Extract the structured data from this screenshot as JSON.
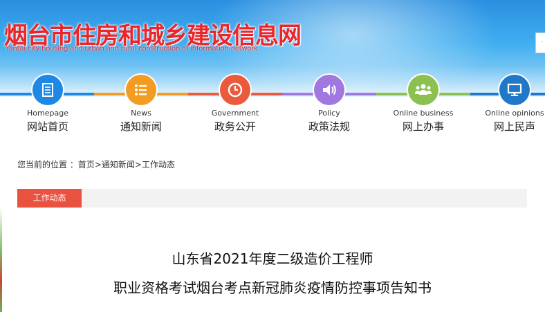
{
  "header": {
    "title": "烟台市住房和城乡建设信息网",
    "subtitle": "Yantai city housing and urban and rural construction of information network"
  },
  "nav": {
    "items": [
      {
        "en": "Homepage",
        "cn": "网站首页",
        "icon": "document-icon",
        "color": "#1e88e5"
      },
      {
        "en": "News",
        "cn": "通知新闻",
        "icon": "list-icon",
        "color": "#f39c23"
      },
      {
        "en": "Government",
        "cn": "政务公开",
        "icon": "clock-icon",
        "color": "#ea5a3d"
      },
      {
        "en": "Policy",
        "cn": "政策法规",
        "icon": "speaker-icon",
        "color": "#a178df"
      },
      {
        "en": "Online business",
        "cn": "网上办事",
        "icon": "people-icon",
        "color": "#8cc152"
      },
      {
        "en": "Online opinions",
        "cn": "网上民声",
        "icon": "monitor-icon",
        "color": "#1f78c8"
      }
    ]
  },
  "breadcrumb": {
    "prefix": "您当前的位置 ：",
    "home": "首页",
    "sep1": ">",
    "news": "通知新闻",
    "sep2": ">",
    "current": "工作动态"
  },
  "section": {
    "tab": "工作动态"
  },
  "article": {
    "title_line1": "山东省2021年度二级造价工程师",
    "title_line2": "职业资格考试烟台考点新冠肺炎疫情防控事项告知书"
  }
}
